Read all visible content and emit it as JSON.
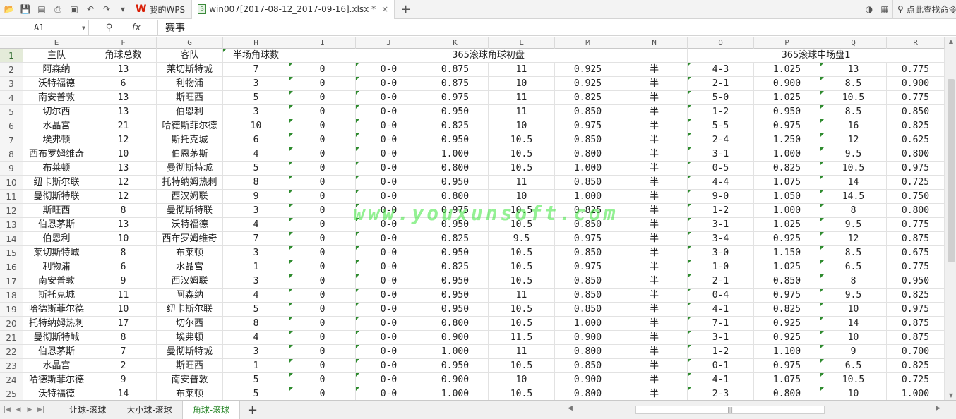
{
  "toolbar": {
    "wps_tab_label": "我的WPS",
    "file_tab_label": "win007[2017-08-12_2017-09-16].xlsx *",
    "search_label": "点此查找命令"
  },
  "formula_bar": {
    "cell_ref": "A1",
    "content": "赛事"
  },
  "columns": [
    "E",
    "F",
    "G",
    "H",
    "I",
    "J",
    "K",
    "L",
    "M",
    "N",
    "O",
    "P",
    "Q",
    "R"
  ],
  "header_row": [
    "主队",
    "角球总数",
    "客队",
    "半场角球数",
    "",
    "",
    "365滚球角球初盘",
    "",
    "",
    "",
    "",
    "365滚球中场盘1",
    "",
    ""
  ],
  "rows": [
    [
      "阿森纳",
      "13",
      "莱切斯特城",
      "7",
      "0",
      "0-0",
      "0.875",
      "11",
      "0.925",
      "半",
      "4-3",
      "1.025",
      "13",
      "0.775"
    ],
    [
      "沃特福德",
      "6",
      "利物浦",
      "3",
      "0",
      "0-0",
      "0.875",
      "10",
      "0.925",
      "半",
      "2-1",
      "0.900",
      "8.5",
      "0.900"
    ],
    [
      "南安普敦",
      "13",
      "斯旺西",
      "5",
      "0",
      "0-0",
      "0.975",
      "11",
      "0.825",
      "半",
      "5-0",
      "1.025",
      "10.5",
      "0.775"
    ],
    [
      "切尔西",
      "13",
      "伯恩利",
      "3",
      "0",
      "0-0",
      "0.950",
      "11",
      "0.850",
      "半",
      "1-2",
      "0.950",
      "8.5",
      "0.850"
    ],
    [
      "水晶宫",
      "21",
      "哈德斯菲尔德",
      "10",
      "0",
      "0-0",
      "0.825",
      "10",
      "0.975",
      "半",
      "5-5",
      "0.975",
      "16",
      "0.825"
    ],
    [
      "埃弗顿",
      "12",
      "斯托克城",
      "6",
      "0",
      "0-0",
      "0.950",
      "10.5",
      "0.850",
      "半",
      "2-4",
      "1.250",
      "12",
      "0.625"
    ],
    [
      "西布罗姆维奇",
      "10",
      "伯恩茅斯",
      "4",
      "0",
      "0-0",
      "1.000",
      "10.5",
      "0.800",
      "半",
      "3-1",
      "1.000",
      "9.5",
      "0.800"
    ],
    [
      "布莱顿",
      "13",
      "曼彻斯特城",
      "5",
      "0",
      "0-0",
      "0.800",
      "10.5",
      "1.000",
      "半",
      "0-5",
      "0.825",
      "10.5",
      "0.975"
    ],
    [
      "纽卡斯尔联",
      "12",
      "托特纳姆热刺",
      "8",
      "0",
      "0-0",
      "0.950",
      "11",
      "0.850",
      "半",
      "4-4",
      "1.075",
      "14",
      "0.725"
    ],
    [
      "曼彻斯特联",
      "12",
      "西汉姆联",
      "9",
      "0",
      "0-0",
      "0.800",
      "10",
      "1.000",
      "半",
      "9-0",
      "1.050",
      "14.5",
      "0.750"
    ],
    [
      "斯旺西",
      "8",
      "曼彻斯特联",
      "3",
      "0",
      "0-0",
      "0.975",
      "10.5",
      "0.825",
      "半",
      "1-2",
      "1.000",
      "8",
      "0.800"
    ],
    [
      "伯恩茅斯",
      "13",
      "沃特福德",
      "4",
      "0",
      "0-0",
      "0.950",
      "10.5",
      "0.850",
      "半",
      "3-1",
      "1.025",
      "9.5",
      "0.775"
    ],
    [
      "伯恩利",
      "10",
      "西布罗姆维奇",
      "7",
      "0",
      "0-0",
      "0.825",
      "9.5",
      "0.975",
      "半",
      "3-4",
      "0.925",
      "12",
      "0.875"
    ],
    [
      "莱切斯特城",
      "8",
      "布莱顿",
      "3",
      "0",
      "0-0",
      "0.950",
      "10.5",
      "0.850",
      "半",
      "3-0",
      "1.150",
      "8.5",
      "0.675"
    ],
    [
      "利物浦",
      "6",
      "水晶宫",
      "1",
      "0",
      "0-0",
      "0.825",
      "10.5",
      "0.975",
      "半",
      "1-0",
      "1.025",
      "6.5",
      "0.775"
    ],
    [
      "南安普敦",
      "9",
      "西汉姆联",
      "3",
      "0",
      "0-0",
      "0.950",
      "10.5",
      "0.850",
      "半",
      "2-1",
      "0.850",
      "8",
      "0.950"
    ],
    [
      "斯托克城",
      "11",
      "阿森纳",
      "4",
      "0",
      "0-0",
      "0.950",
      "11",
      "0.850",
      "半",
      "0-4",
      "0.975",
      "9.5",
      "0.825"
    ],
    [
      "哈德斯菲尔德",
      "10",
      "纽卡斯尔联",
      "5",
      "0",
      "0-0",
      "0.950",
      "10.5",
      "0.850",
      "半",
      "4-1",
      "0.825",
      "10",
      "0.975"
    ],
    [
      "托特纳姆热刺",
      "17",
      "切尔西",
      "8",
      "0",
      "0-0",
      "0.800",
      "10.5",
      "1.000",
      "半",
      "7-1",
      "0.925",
      "14",
      "0.875"
    ],
    [
      "曼彻斯特城",
      "8",
      "埃弗顿",
      "4",
      "0",
      "0-0",
      "0.900",
      "11.5",
      "0.900",
      "半",
      "3-1",
      "0.925",
      "10",
      "0.875"
    ],
    [
      "伯恩茅斯",
      "7",
      "曼彻斯特城",
      "3",
      "0",
      "0-0",
      "1.000",
      "11",
      "0.800",
      "半",
      "1-2",
      "1.100",
      "9",
      "0.700"
    ],
    [
      "水晶宫",
      "2",
      "斯旺西",
      "1",
      "0",
      "0-0",
      "0.950",
      "10.5",
      "0.850",
      "半",
      "0-1",
      "0.975",
      "6.5",
      "0.825"
    ],
    [
      "哈德斯菲尔德",
      "9",
      "南安普敦",
      "5",
      "0",
      "0-0",
      "0.900",
      "10",
      "0.900",
      "半",
      "4-1",
      "1.075",
      "10.5",
      "0.725"
    ],
    [
      "沃特福德",
      "14",
      "布莱顿",
      "5",
      "0",
      "0-0",
      "1.000",
      "10.5",
      "0.800",
      "半",
      "2-3",
      "0.800",
      "10",
      "1.000"
    ]
  ],
  "watermark": "www.youxunsoft.com",
  "sheets": [
    "让球-滚球",
    "大小球-滚球",
    "角球-滚球"
  ],
  "active_sheet": 2
}
